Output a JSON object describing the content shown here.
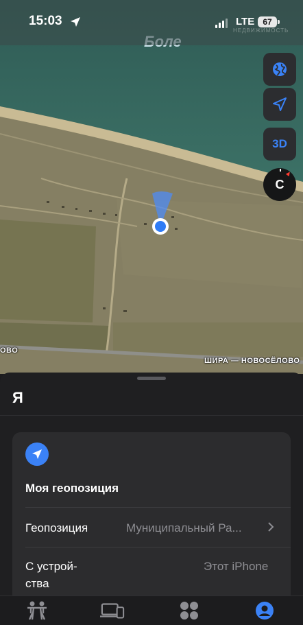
{
  "status_bar": {
    "time": "15:03",
    "network": "LTE",
    "battery": "67"
  },
  "watermark": "НЕДВИЖИМОСТЬ",
  "map": {
    "label_top": "Боле",
    "road_label_left": "ОВО",
    "road_label_right": "ШИРА — НОВОСЁЛОВО",
    "controls": {
      "three_d_label": "3D",
      "compass_label": "С"
    }
  },
  "sheet": {
    "title": "Я",
    "card": {
      "heading": "Моя геопозиция",
      "location_label": "Геопозиция",
      "location_value": "Муниципальный Ра...",
      "device_label_line1": "С устрой-",
      "device_label_line2": "ства",
      "device_value": "Этот iPhone"
    }
  },
  "tab_bar": {
    "tabs": [
      {
        "icon": "people-icon",
        "active": false
      },
      {
        "icon": "devices-icon",
        "active": false
      },
      {
        "icon": "items-icon",
        "active": false
      },
      {
        "icon": "me-icon",
        "active": true
      }
    ]
  },
  "colors": {
    "accent": "#3b82f6",
    "sheet_bg": "#1f1f21",
    "card_bg": "#2c2c2e"
  }
}
